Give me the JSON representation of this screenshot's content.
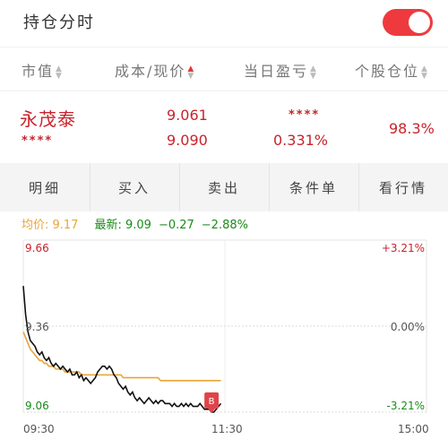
{
  "header": {
    "title": "持仓分时",
    "toggle_on": true,
    "toggle_color": "#ee3a3e"
  },
  "columns": [
    {
      "label": "市值"
    },
    {
      "label": "成本/现价"
    },
    {
      "label": "当日盈亏"
    },
    {
      "label": "个股仓位"
    }
  ],
  "holding": {
    "name": "永茂泰",
    "market_value_hidden": "****",
    "cost": "9.061",
    "price": "9.090",
    "pnl_hidden": "****",
    "pnl_pct": "0.331%",
    "position_pct": "98.3%"
  },
  "tabs": [
    "明细",
    "买入",
    "卖出",
    "条件单",
    "看行情"
  ],
  "info": {
    "avg_label": "均价: 9.17",
    "latest_label": "最新: 9.09",
    "change": "−0.27",
    "change_pct": "−2.88%"
  },
  "chart_data": {
    "type": "line",
    "y_labels_left": [
      "9.66",
      "9.36",
      "9.06"
    ],
    "y_labels_right": [
      "+3.21%",
      "0.00%",
      "-3.21%"
    ],
    "x_labels": [
      "09:30",
      "11:30",
      "15:00"
    ],
    "ylim": [
      9.06,
      9.66
    ],
    "prev_close": 9.36,
    "buy_marker": "B",
    "colors": {
      "price": "#111111",
      "avg": "#e8a53a",
      "up": "#c8232b",
      "down": "#1b8a1b",
      "marker": "#e0444a"
    },
    "series": [
      {
        "role": "price",
        "values": [
          9.5,
          9.4,
          9.34,
          9.31,
          9.3,
          9.29,
          9.27,
          9.26,
          9.27,
          9.25,
          9.24,
          9.25,
          9.23,
          9.22,
          9.23,
          9.22,
          9.21,
          9.22,
          9.21,
          9.2,
          9.21,
          9.19,
          9.19,
          9.2,
          9.18,
          9.19,
          9.17,
          9.18,
          9.17,
          9.16,
          9.17,
          9.18,
          9.2,
          9.21,
          9.22,
          9.22,
          9.21,
          9.22,
          9.21,
          9.19,
          9.18,
          9.16,
          9.15,
          9.14,
          9.15,
          9.13,
          9.12,
          9.13,
          9.11,
          9.1,
          9.11,
          9.1,
          9.09,
          9.1,
          9.11,
          9.1,
          9.09,
          9.1,
          9.09,
          9.1,
          9.1,
          9.09,
          9.09,
          9.09,
          9.08,
          9.09,
          9.08,
          9.08,
          9.09,
          9.08,
          9.09,
          9.08,
          9.09,
          9.08,
          9.08,
          9.08,
          9.09,
          9.08,
          9.07,
          9.07,
          9.07,
          9.06,
          9.06,
          9.07,
          9.08,
          9.09
        ]
      },
      {
        "role": "avg",
        "values": [
          9.34,
          9.32,
          9.3,
          9.28,
          9.27,
          9.26,
          9.25,
          9.24,
          9.24,
          9.23,
          9.23,
          9.22,
          9.22,
          9.22,
          9.21,
          9.21,
          9.21,
          9.21,
          9.2,
          9.2,
          9.2,
          9.2,
          9.2,
          9.2,
          9.2,
          9.19,
          9.19,
          9.19,
          9.19,
          9.19,
          9.19,
          9.19,
          9.19,
          9.19,
          9.19,
          9.19,
          9.19,
          9.19,
          9.19,
          9.19,
          9.19,
          9.19,
          9.19,
          9.18,
          9.18,
          9.18,
          9.18,
          9.18,
          9.18,
          9.18,
          9.18,
          9.18,
          9.18,
          9.18,
          9.18,
          9.18,
          9.18,
          9.18,
          9.18,
          9.17,
          9.17,
          9.17,
          9.17,
          9.17,
          9.17,
          9.17,
          9.17,
          9.17,
          9.17,
          9.17,
          9.17,
          9.17,
          9.17,
          9.17,
          9.17,
          9.17,
          9.17,
          9.17,
          9.17,
          9.17,
          9.17,
          9.17,
          9.17,
          9.17,
          9.17,
          9.17
        ]
      }
    ],
    "session_fraction_shown": 0.49
  }
}
